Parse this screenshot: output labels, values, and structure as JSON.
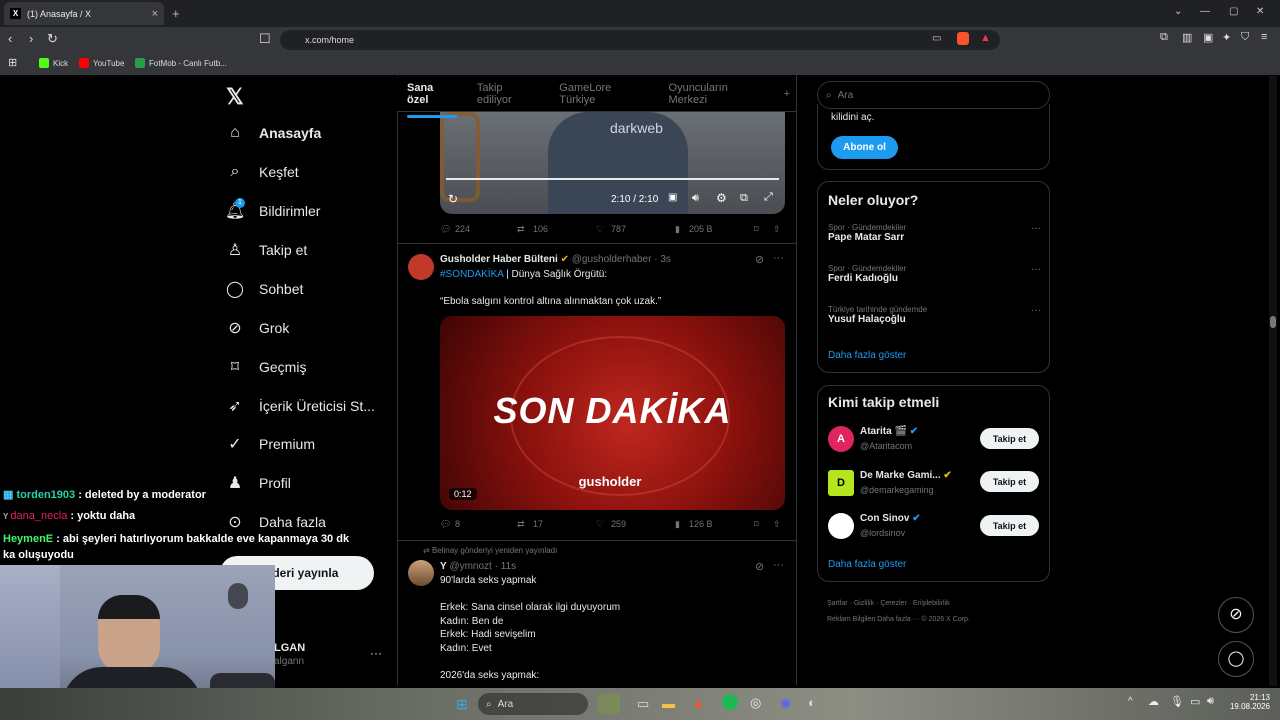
{
  "browser": {
    "tab_title": "(1) Anasayfa / X",
    "url": "x.com/home",
    "bookmarks": [
      "Kick",
      "YouTube",
      "FotMob - Canlı Futb..."
    ]
  },
  "sidebar": {
    "items": [
      {
        "label": "Anasayfa",
        "icon": "home-icon"
      },
      {
        "label": "Keşfet",
        "icon": "search-icon"
      },
      {
        "label": "Bildirimler",
        "icon": "bell-icon",
        "badge": "1"
      },
      {
        "label": "Takip et",
        "icon": "add-person-icon"
      },
      {
        "label": "Sohbet",
        "icon": "chat-icon"
      },
      {
        "label": "Grok",
        "icon": "grok-icon"
      },
      {
        "label": "Geçmiş",
        "icon": "bookmark-icon"
      },
      {
        "label": "İçerik Üreticisi St...",
        "icon": "rocket-icon"
      },
      {
        "label": "Premium",
        "icon": "verified-icon"
      },
      {
        "label": "Profil",
        "icon": "person-icon"
      },
      {
        "label": "Daha fazla",
        "icon": "more-icon"
      }
    ],
    "post_button": "Gönderiyi yayınla",
    "user_name": "ALGAN",
    "user_handle": "@algann",
    "post_button_partial": "nderi yayınla",
    "user_name_partial": "LGAN",
    "user_handle_partial": "algann"
  },
  "tabs": [
    "Sana özel",
    "Takip ediliyor",
    "GameLore Türkiye",
    "Oyuncuların Merkezi"
  ],
  "tweet1": {
    "video_time": "2:10 / 2:10",
    "replies": "224",
    "retweets": "106",
    "likes": "787",
    "views": "205 B",
    "watermark": "darkweb"
  },
  "tweet2": {
    "name": "Gusholder Haber Bülteni",
    "handle": "@gusholderhaber",
    "time": "3s",
    "hashtag": "#SONDAKİKA",
    "text1": " | Dünya Sağlık Örgütü:",
    "text2": "“Ebola salgını kontrol altına alınmaktan çok uzak.”",
    "image_title": "SON DAKİKA",
    "image_brand": "gusholder",
    "duration": "0:12",
    "replies": "8",
    "retweets": "17",
    "likes": "259",
    "views": "126 B"
  },
  "tweet3": {
    "repost_label": "Belinay gönderiyi yeniden yayınladı",
    "name": "Y",
    "handle": "@ymnozt",
    "time": "11s",
    "lines": [
      "90'larda seks yapmak",
      "",
      "Erkek: Sana cinsel olarak ilgi duyuyorum",
      "Kadın: Ben de",
      "Erkek: Hadi sevişelim",
      "Kadın: Evet",
      "",
      "2026'da seks yapmak:"
    ]
  },
  "search": {
    "placeholder": "Ara"
  },
  "subscribe": {
    "text": "kilidini aç.",
    "button": "Abone ol"
  },
  "trends": {
    "title": "Neler oluyor?",
    "items": [
      {
        "category": "Spor · Gündemdekiler",
        "name": "Pape Matar Sarr"
      },
      {
        "category": "Spor · Gündemdekiler",
        "name": "Ferdi Kadıoğlu"
      },
      {
        "category": "Türkiye tarihinde gündemde",
        "name": "Yusuf Halaçoğlu"
      }
    ],
    "more": "Daha fazla göster"
  },
  "who_to_follow": {
    "title": "Kimi takip etmeli",
    "items": [
      {
        "name": "Atarita 🎬",
        "handle": "@Ataritacom",
        "button": "Takip et",
        "color": "#e0245e"
      },
      {
        "name": "De Marke Gami...",
        "handle": "@demarkegaming",
        "button": "Takip et",
        "color": "#b5e61d"
      },
      {
        "name": "Con Sinov",
        "handle": "@lordsinov",
        "button": "Takip et",
        "color": "#ffffff"
      }
    ],
    "more": "Daha fazla göster"
  },
  "footer": {
    "line1": [
      "Şartlar",
      "Gizlilik",
      "Çerezler",
      "Erişilebilirlik"
    ],
    "line2": "Reklam Bilgileri   Daha fazla ···   © 2026 X Corp."
  },
  "chat": [
    {
      "user": "torden1903",
      "message": " : deleted by a moderator",
      "color": "#1fd6a9"
    },
    {
      "user": "dana_necla",
      "message": " : yoktu daha",
      "color": "#e0245e"
    },
    {
      "user": "HeymenE",
      "message": " : abi şeyleri hatırlıyorum bakkalde eve kapanmaya 30 dk ka oluşuyodu",
      "color": "#42f56c"
    }
  ],
  "taskbar": {
    "search": "Ara",
    "time": "21:13",
    "date": "19.08.2026"
  }
}
